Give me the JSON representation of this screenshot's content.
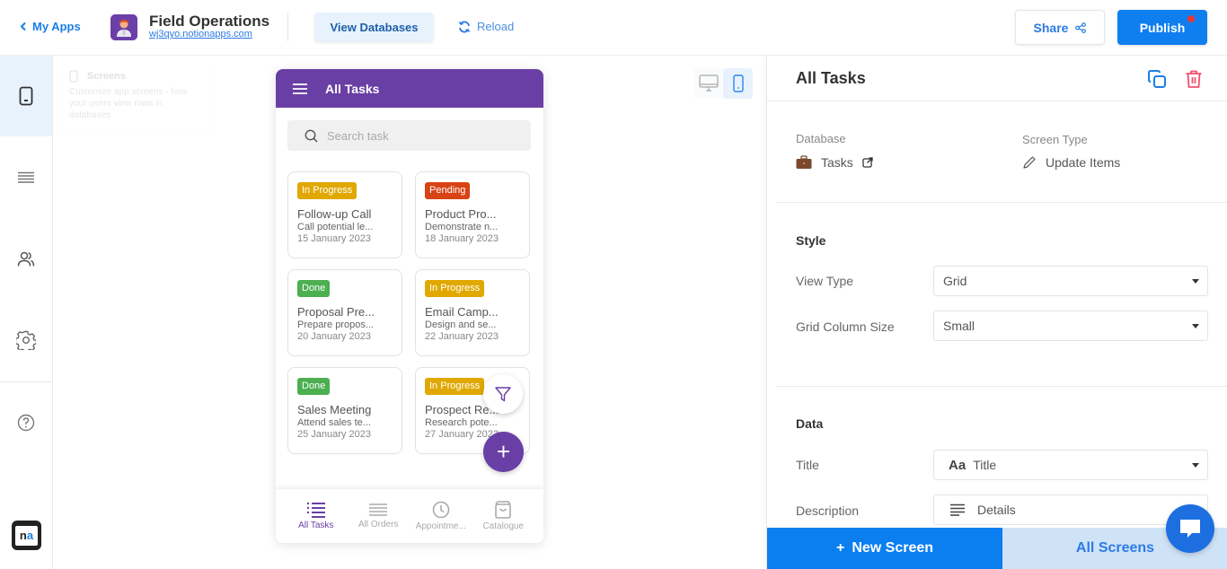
{
  "topbar": {
    "back_label": "My Apps",
    "app_name": "Field Operations",
    "app_url": "wj3qyo.notionapps.com",
    "view_databases": "View Databases",
    "reload": "Reload",
    "share": "Share",
    "publish": "Publish"
  },
  "sidebar": {
    "items": [
      {
        "name": "screens",
        "icon": "mobile-icon",
        "active": true
      },
      {
        "name": "databases",
        "icon": "list-icon",
        "active": false
      },
      {
        "name": "users",
        "icon": "users-icon",
        "active": false
      },
      {
        "name": "settings",
        "icon": "gear-icon",
        "active": false
      },
      {
        "name": "help",
        "icon": "help-icon",
        "active": false
      }
    ],
    "logo_n": "n",
    "logo_a": "a"
  },
  "canvas": {
    "tooltip": {
      "title": "Screens",
      "description": "Customize app screens - how your users view rows in databases"
    },
    "device_toggle": {
      "selected": "mobile"
    }
  },
  "phone": {
    "header_title": "All Tasks",
    "search_placeholder": "Search task",
    "cards": [
      {
        "status": "In Progress",
        "status_color": "#e0a800",
        "title": "Follow-up Call",
        "description": "Call potential le...",
        "date": "15 January 2023"
      },
      {
        "status": "Pending",
        "status_color": "#d84315",
        "title": "Product Pro...",
        "description": "Demonstrate n...",
        "date": "18 January 2023"
      },
      {
        "status": "Done",
        "status_color": "#4caf50",
        "title": "Proposal Pre...",
        "description": "Prepare propos...",
        "date": "20 January 2023"
      },
      {
        "status": "In Progress",
        "status_color": "#e0a800",
        "title": "Email Camp...",
        "description": "Design and se...",
        "date": "22 January 2023"
      },
      {
        "status": "Done",
        "status_color": "#4caf50",
        "title": "Sales Meeting",
        "description": "Attend sales te...",
        "date": "25 January 2023"
      },
      {
        "status": "In Progress",
        "status_color": "#e0a800",
        "title": "Prospect Re...",
        "description": "Research pote...",
        "date": "27 January 2023"
      }
    ],
    "nav": [
      {
        "label": "All Tasks",
        "icon": "task-list-icon",
        "active": true
      },
      {
        "label": "All Orders",
        "icon": "list-icon",
        "active": false
      },
      {
        "label": "Appointme...",
        "icon": "clock-icon",
        "active": false
      },
      {
        "label": "Catalogue",
        "icon": "bag-icon",
        "active": false
      }
    ],
    "add_label": "+"
  },
  "panel": {
    "title": "All Tasks",
    "database_label": "Database",
    "database_value": "Tasks",
    "screen_type_label": "Screen Type",
    "screen_type_value": "Update Items",
    "style_section": "Style",
    "view_type_label": "View Type",
    "view_type_value": "Grid",
    "grid_column_label": "Grid Column Size",
    "grid_column_value": "Small",
    "data_section": "Data",
    "title_label": "Title",
    "title_prefix": "Aa",
    "title_value": "Title",
    "description_label": "Description",
    "description_value": "Details",
    "new_screen": "New Screen",
    "new_screen_prefix": "+",
    "all_screens": "All Screens"
  },
  "colors": {
    "accent_blue": "#0f7ff0",
    "brand_purple": "#6a3fa5",
    "delete_red": "#f0506e"
  }
}
